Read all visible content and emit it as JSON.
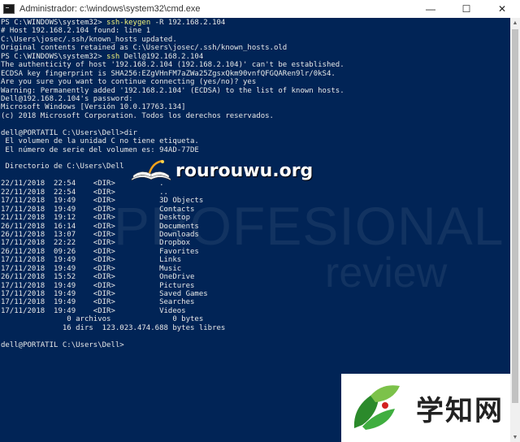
{
  "window": {
    "title": "Administrador: c:\\windows\\system32\\cmd.exe",
    "controls": {
      "minimize": "—",
      "maximize": "☐",
      "close": "✕"
    }
  },
  "console": {
    "lines": [
      [
        {
          "t": "PS C:\\WINDOWS\\system32> "
        },
        {
          "t": "ssh-keygen",
          "c": "cmd"
        },
        {
          "t": " -R 192.168.2.104"
        }
      ],
      [
        {
          "t": "# Host 192.168.2.104 found: line 1"
        }
      ],
      [
        {
          "t": "C:\\Users\\josec/.ssh/known_hosts updated."
        }
      ],
      [
        {
          "t": "Original contents retained as C:\\Users\\josec/.ssh/known_hosts.old"
        }
      ],
      [
        {
          "t": "PS C:\\WINDOWS\\system32> "
        },
        {
          "t": "ssh",
          "c": "cmd"
        },
        {
          "t": " Dell@192.168.2.104"
        }
      ],
      [
        {
          "t": "The authenticity of host '192.168.2.104 (192.168.2.104)' can't be established."
        }
      ],
      [
        {
          "t": "ECDSA key fingerprint is SHA256:EZgVHnFM7aZWa25ZgsxQkm90vnfQFGQARen9lr/0kS4."
        }
      ],
      [
        {
          "t": "Are you sure you want to continue connecting (yes/no)? yes"
        }
      ],
      [
        {
          "t": "Warning: Permanently added '192.168.2.104' (ECDSA) to the list of known hosts."
        }
      ],
      [
        {
          "t": "Dell@192.168.2.104's password:"
        }
      ],
      [
        {
          "t": "Microsoft Windows [Versión 10.0.17763.134]"
        }
      ],
      [
        {
          "t": "(c) 2018 Microsoft Corporation. Todos los derechos reservados."
        }
      ],
      [
        {
          "t": ""
        }
      ],
      [
        {
          "t": "dell@PORTATIL C:\\Users\\Dell>dir"
        }
      ],
      [
        {
          "t": " El volumen de la unidad C no tiene etiqueta."
        }
      ],
      [
        {
          "t": " El número de serie del volumen es: 94AD-77DE"
        }
      ],
      [
        {
          "t": ""
        }
      ],
      [
        {
          "t": " Directorio de C:\\Users\\Dell"
        }
      ],
      [
        {
          "t": ""
        }
      ],
      [
        {
          "t": "22/11/2018  22:54    <DIR>          ."
        }
      ],
      [
        {
          "t": "22/11/2018  22:54    <DIR>          .."
        }
      ],
      [
        {
          "t": "17/11/2018  19:49    <DIR>          3D Objects"
        }
      ],
      [
        {
          "t": "17/11/2018  19:49    <DIR>          Contacts"
        }
      ],
      [
        {
          "t": "21/11/2018  19:12    <DIR>          Desktop"
        }
      ],
      [
        {
          "t": "26/11/2018  16:14    <DIR>          Documents"
        }
      ],
      [
        {
          "t": "26/11/2018  13:07    <DIR>          Downloads"
        }
      ],
      [
        {
          "t": "17/11/2018  22:22    <DIR>          Dropbox"
        }
      ],
      [
        {
          "t": "26/11/2018  09:26    <DIR>          Favorites"
        }
      ],
      [
        {
          "t": "17/11/2018  19:49    <DIR>          Links"
        }
      ],
      [
        {
          "t": "17/11/2018  19:49    <DIR>          Music"
        }
      ],
      [
        {
          "t": "26/11/2018  15:52    <DIR>          OneDrive"
        }
      ],
      [
        {
          "t": "17/11/2018  19:49    <DIR>          Pictures"
        }
      ],
      [
        {
          "t": "17/11/2018  19:49    <DIR>          Saved Games"
        }
      ],
      [
        {
          "t": "17/11/2018  19:49    <DIR>          Searches"
        }
      ],
      [
        {
          "t": "17/11/2018  19:49    <DIR>          Videos"
        }
      ],
      [
        {
          "t": "               0 archivos              0 bytes"
        }
      ],
      [
        {
          "t": "              16 dirs  123.023.474.688 bytes libres"
        }
      ],
      [
        {
          "t": ""
        }
      ],
      [
        {
          "t": "dell@PORTATIL C:\\Users\\Dell>"
        }
      ]
    ]
  },
  "watermarks": {
    "overlay_text": "rourouwu.org",
    "background_text_1": "PROFESIONAL",
    "background_text_2": "review",
    "badge_text": "学知网"
  },
  "colors": {
    "console_bg": "#012456",
    "console_text": "#e8e8e8",
    "command_highlight": "#f4f27a"
  }
}
